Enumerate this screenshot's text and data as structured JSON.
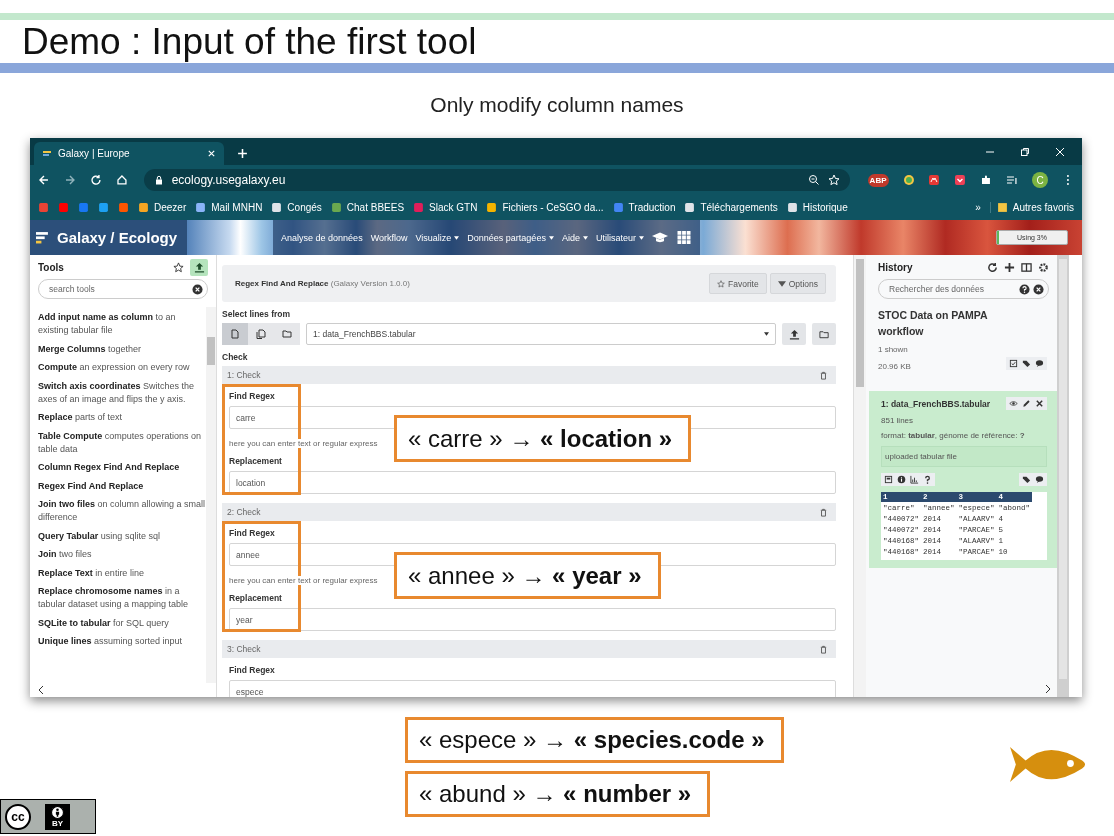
{
  "slide": {
    "title": "Demo : Input of the first tool",
    "subtitle": "Only modify column names"
  },
  "browser": {
    "tab": {
      "title": "Galaxy | Europe"
    },
    "url": "ecology.usegalaxy.eu",
    "extension_badge": "ABP",
    "avatar": "C",
    "bookmarks": [
      {
        "color": "#ea4335"
      },
      {
        "color": "#ff0000"
      },
      {
        "color": "#1877f2"
      },
      {
        "color": "#1da1f2"
      },
      {
        "color": "#ff5500"
      },
      {
        "label": "Deezer",
        "color": "#f5a623"
      },
      {
        "label": "Mail MNHN",
        "color": "#8ab4f8"
      },
      {
        "label": "Congés",
        "color": "#dfe3e8"
      },
      {
        "label": "Chat BBEES",
        "color": "#6aa84f"
      },
      {
        "label": "Slack GTN",
        "color": "#e01e5a"
      },
      {
        "label": "Fichiers - CeSGO da...",
        "color": "#f4b400"
      },
      {
        "label": "Traduction",
        "color": "#4285f4"
      },
      {
        "label": "Téléchargements",
        "color": "#dfe3e8"
      },
      {
        "label": "Historique",
        "color": "#dfe3e8"
      }
    ],
    "more": "»",
    "other_bookmarks": "Autres favoris"
  },
  "galaxy": {
    "brand": "Galaxy / Ecology",
    "nav": [
      {
        "label": "Analyse de données",
        "dropdown": false
      },
      {
        "label": "Workflow",
        "dropdown": false
      },
      {
        "label": "Visualize",
        "dropdown": true
      },
      {
        "label": "Données partagées",
        "dropdown": true
      },
      {
        "label": "Aide",
        "dropdown": true
      },
      {
        "label": "Utilisateur",
        "dropdown": true
      }
    ],
    "quota": {
      "label": "Using 3%",
      "level": 0.03
    }
  },
  "tools": {
    "title": "Tools",
    "placeholder": "search tools",
    "items": [
      {
        "name": "Add input name as column",
        "desc": "to an existing tabular file"
      },
      {
        "name": "Merge Columns",
        "desc": "together"
      },
      {
        "name": "Compute",
        "desc": "an expression on every row"
      },
      {
        "name": "Switch axis coordinates",
        "desc": "Switches the axes of an image and flips the y axis."
      },
      {
        "name": "Replace",
        "desc": "parts of text"
      },
      {
        "name": "Table Compute",
        "desc": "computes operations on table data"
      },
      {
        "name": "Column Regex Find And Replace"
      },
      {
        "name": "Regex Find And Replace"
      },
      {
        "name": "Join two files",
        "desc": "on column allowing a small difference"
      },
      {
        "name": "Query Tabular",
        "desc": "using sqlite sql"
      },
      {
        "name": "Join",
        "desc": "two files"
      },
      {
        "name": "Replace Text",
        "desc": "in entire line"
      },
      {
        "name": "Replace chromosome names",
        "desc": "in a tabular dataset using a mapping table"
      },
      {
        "name": "SQLite to tabular",
        "desc": "for SQL query"
      },
      {
        "name": "Unique lines",
        "desc": "assuming sorted input"
      }
    ]
  },
  "tool_form": {
    "title": "Regex Find And Replace",
    "version": "(Galaxy Version 1.0.0)",
    "buttons": [
      {
        "label": "Favorite",
        "kind": "star"
      },
      {
        "label": "Options",
        "kind": "dropdown"
      }
    ],
    "input": {
      "label": "Select lines from",
      "sources": [
        {
          "kind": "file",
          "selected": true
        },
        {
          "kind": "files",
          "selected": false
        },
        {
          "kind": "folder",
          "selected": false
        }
      ],
      "value": "1: data_FrenchBBS.tabular"
    },
    "repeat_title": "Check",
    "checks": [
      {
        "title": "1: Check",
        "highlighted": true,
        "callout": "« carre » → **« location »**",
        "fields": [
          {
            "label": "Find Regex",
            "value": "carre",
            "help": "here you can enter text or regular express"
          },
          {
            "label": "Replacement",
            "value": "location"
          }
        ]
      },
      {
        "title": "2: Check",
        "highlighted": true,
        "callout": "« annee » → **« year »**",
        "fields": [
          {
            "label": "Find Regex",
            "value": "annee",
            "help": "here you can enter text or regular express"
          },
          {
            "label": "Replacement",
            "value": "year"
          }
        ]
      },
      {
        "title": "3: Check",
        "highlighted": false,
        "fields": [
          {
            "label": "Find Regex",
            "value": "espece"
          }
        ]
      }
    ]
  },
  "history": {
    "title": "History",
    "placeholder": "Rechercher des données",
    "name": "STOC Data on PAMPA workflow",
    "shown": "1 shown",
    "size": "20.96 KB",
    "datasets": [
      {
        "title": "1: data_FrenchBBS.tabular",
        "lines": "851 lines",
        "format": "format: **tabular**, génome de référence: **?**",
        "info": "uploaded tabular file",
        "peek": {
          "columns": [
            "1",
            "2",
            "3",
            "4"
          ],
          "rows": [
            [
              "\"carre\"",
              "\"annee\"",
              "\"espece\"",
              "\"abond\""
            ],
            [
              "\"440072\"",
              "2014",
              "\"ALAARV\"",
              "4"
            ],
            [
              "\"440072\"",
              "2014",
              "\"PARCAE\"",
              "5"
            ],
            [
              "\"440168\"",
              "2014",
              "\"ALAARV\"",
              "1"
            ],
            [
              "\"440168\"",
              "2014",
              "\"PARCAE\"",
              "10"
            ]
          ]
        }
      }
    ]
  },
  "bottom_callouts": [
    {
      "text": "« espece » → **« species.code »**"
    },
    {
      "text": "« abund » → **« number »**"
    }
  ],
  "license": {
    "mark": "cc",
    "label": "BY"
  }
}
